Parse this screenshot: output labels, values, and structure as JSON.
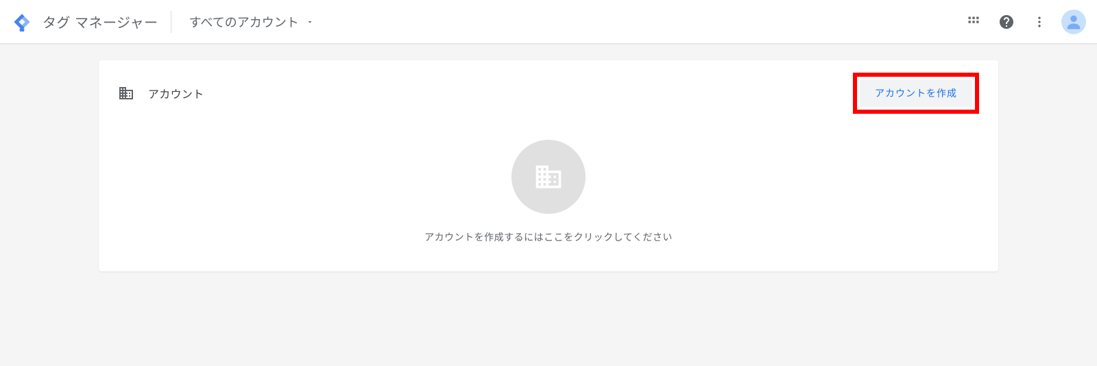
{
  "header": {
    "app_title": "タグ マネージャー",
    "account_selector_label": "すべてのアカウント"
  },
  "card": {
    "title": "アカウント",
    "create_button_label": "アカウントを作成",
    "empty_state_text": "アカウントを作成するにはここをクリックしてください"
  },
  "colors": {
    "brand_blue": "#1a73e8",
    "highlight_red": "#ff0000",
    "text_gray": "#5f6368"
  }
}
